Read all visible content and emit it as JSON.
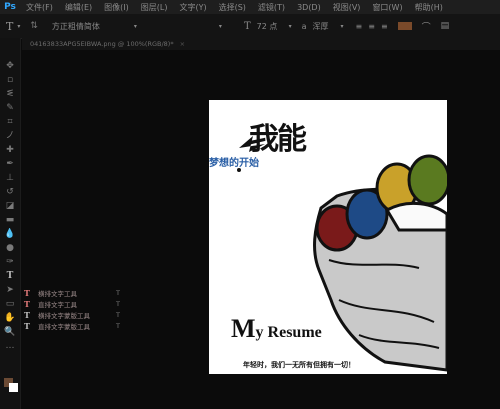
{
  "app": {
    "logo": "Ps"
  },
  "menu": [
    "文件(F)",
    "编辑(E)",
    "图像(I)",
    "图层(L)",
    "文字(Y)",
    "选择(S)",
    "滤镜(T)",
    "3D(D)",
    "视图(V)",
    "窗口(W)",
    "帮助(H)"
  ],
  "options": {
    "font_family": "方正粗倩简体",
    "font_size": "72 点",
    "antialias": "a",
    "aa_mode": "浑厚"
  },
  "document": {
    "tab_title": "04163833APG5EIBWA.png @ 100%(RGB/8)*"
  },
  "poster": {
    "headline": "我能",
    "subtitle": "梦想的开始",
    "resume_big": "M",
    "resume_rest": "y Resume",
    "slogan": "年轻时，我们一无所有但拥有一切！"
  },
  "type_tool_flyout": {
    "items": [
      {
        "label": "横排文字工具",
        "key": "T",
        "icon": "horizontal-type-icon"
      },
      {
        "label": "直排文字工具",
        "key": "T",
        "icon": "vertical-type-icon"
      },
      {
        "label": "横排文字蒙版工具",
        "key": "T",
        "icon": "horizontal-type-mask-icon"
      },
      {
        "label": "直排文字蒙版工具",
        "key": "T",
        "icon": "vertical-type-mask-icon"
      }
    ]
  },
  "colors": {
    "foreground": "#6b4a34",
    "background": "#ffffff",
    "text_color_swatch": "#7a4a2a"
  }
}
